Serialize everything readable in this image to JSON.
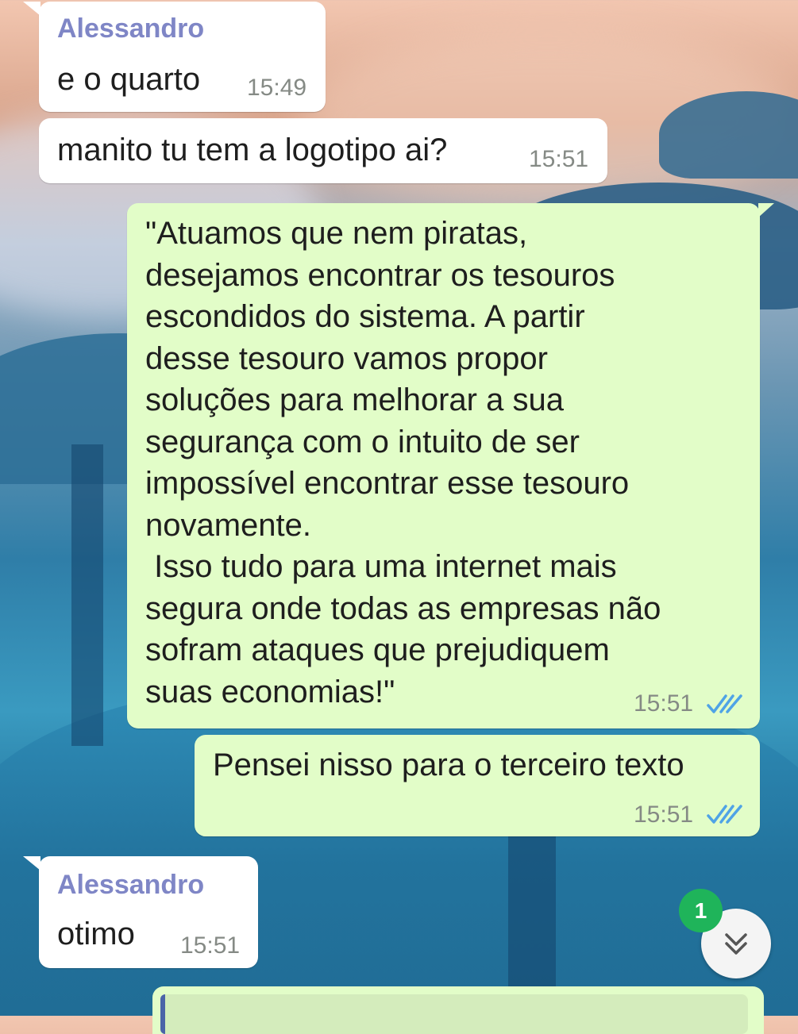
{
  "theme": {
    "incoming_bubble": "#ffffff",
    "outgoing_bubble": "#e2fdc8",
    "sender_name_color": "#7f86c6",
    "read_tick_color": "#4fa3e6",
    "badge_color": "#1fb45a"
  },
  "messages": [
    {
      "direction": "incoming",
      "sender": "Alessandro",
      "text": "e o quarto",
      "time": "15:49"
    },
    {
      "direction": "incoming",
      "text": "manito tu tem a logotipo ai?",
      "time": "15:51"
    },
    {
      "direction": "outgoing",
      "text": "\"Atuamos que nem piratas,\ndesejamos encontrar os tesouros\nescondidos do sistema. A partir\ndesse tesouro vamos propor\nsoluções para melhorar a sua\nsegurança com o intuito de ser\nimpossível encontrar esse tesouro\nnovamente.\n Isso tudo para uma internet mais\nsegura onde todas as empresas não\nsofram ataques que prejudiquem\nsuas economias!\"",
      "time": "15:51",
      "status": "read"
    },
    {
      "direction": "outgoing",
      "text": "Pensei nisso para o terceiro texto",
      "time": "15:51",
      "status": "read"
    },
    {
      "direction": "incoming",
      "sender": "Alessandro",
      "text": "otimo",
      "time": "15:51"
    }
  ],
  "scroll_button": {
    "unread_count": "1",
    "icon": "double-chevron-down-icon"
  }
}
